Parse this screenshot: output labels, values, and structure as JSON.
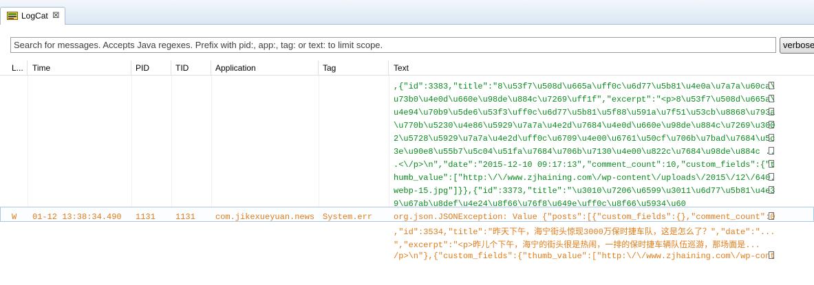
{
  "tab": {
    "title": "LogCat",
    "close_glyph": "⊠"
  },
  "search": {
    "placeholder": "Search for messages. Accepts Java regexes. Prefix with pid:, app:, tag: or text: to limit scope."
  },
  "level_select": {
    "value": "verbose"
  },
  "columns": {
    "level": "L...",
    "time": "Time",
    "pid": "PID",
    "tid": "TID",
    "application": "Application",
    "tag": "Tag",
    "text": "Text"
  },
  "verbose_lines": [
    ",{\"id\":3383,\"title\":\"8\\u53f7\\u508d\\u665a\\uff0c\\u6d77\\u5b81\\u4e0a\\u7a7a\\u60ca\\",
    "u73b0\\u4e0d\\u660e\\u98de\\u884c\\u7269\\uff1f\",\"excerpt\":\"<p>8\\u53f7\\u508d\\u665a\\",
    "u4e94\\u70b9\\u5de6\\u53f3\\uff0c\\u6d77\\u5b81\\u5f88\\u591a\\u7f51\\u53cb\\u8868\\u793a",
    "\\u770b\\u5230\\u4e86\\u5929\\u7a7a\\u4e2d\\u7684\\u4e0d\\u660e\\u98de\\u884c\\u7269\\u300",
    "2\\u5728\\u5929\\u7a7a\\u4e2d\\uff0c\\u6709\\u4e00\\u6761\\u50cf\\u706b\\u7bad\\u7684\\u5c",
    "3e\\u90e8\\u55b7\\u5c04\\u51fa\\u7684\\u706b\\u7130\\u4e00\\u822c\\u7684\\u98de\\u884c ..",
    ".<\\/p>\\n\",\"date\":\"2015-12-10 09:17:13\",\"comment_count\":10,\"custom_fields\":{\"t",
    "humb_value\":[\"http:\\/\\/www.zjhaining.com\\/wp-content\\/uploads\\/2015\\/12\\/640.",
    "webp-15.jpg\"]}},{\"id\":3373,\"title\":\"\\u3010\\u7206\\u6599\\u3011\\u6d77\\u5b81\\u4e3",
    "9\\u67ab\\u8def\\u4e24\\u8f66\\u76f8\\u649e\\uff0c\\u8f66\\u5934\\u60"
  ],
  "warn_row": {
    "level": "W",
    "time": "01-12 13:38:34.490",
    "pid": "1131",
    "tid": "1131",
    "application": "com.jikexueyuan.news",
    "tag": "System.err",
    "lines": [
      "org.json.JSONException: Value {\"posts\":[{\"custom_fields\":{},\"comment_count\":0",
      ",\"id\":3534,\"title\":\"昨天下午，海宁街头惊现3000万保时捷车队，这是怎么了？\",\"date\":\"...",
      "\",\"excerpt\":\"<p>昨儿个下午，海宁的街头很是热闹，一排的保时捷车辆队伍巡游，那场面是...",
      "/p>\\n\"},{\"custom_fields\":{\"thumb_value\":[\"http:\\/\\/www.zjhaining.com\\/wp-cont"
    ]
  },
  "colors": {
    "verbose_text": "#0a8a1e",
    "warn_text": "#e07c18"
  }
}
